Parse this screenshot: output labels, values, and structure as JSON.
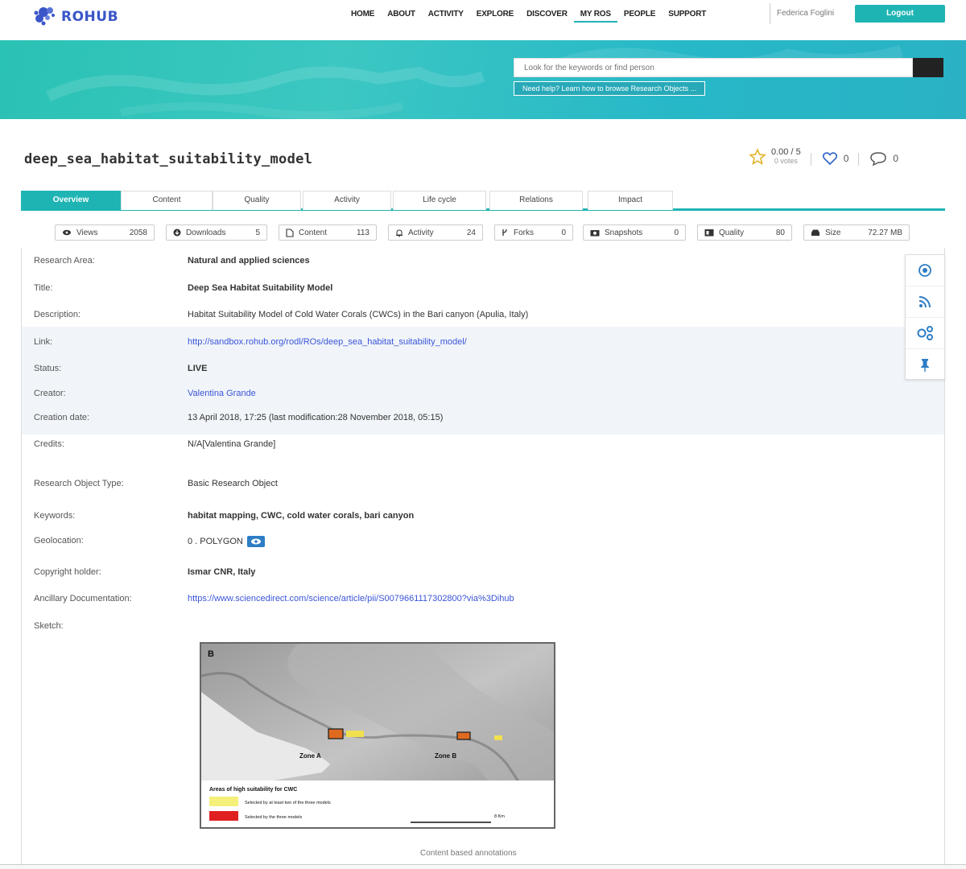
{
  "header": {
    "logo_text": "ROHUB",
    "nav": [
      "HOME",
      "ABOUT",
      "ACTIVITY",
      "EXPLORE",
      "DISCOVER",
      "MY ROS",
      "PEOPLE",
      "SUPPORT"
    ],
    "active_nav": "MY ROS",
    "user_name": "Federica Foglini",
    "logout_label": "Logout",
    "accent_color": "#1fb4b4"
  },
  "search": {
    "placeholder": "Look for the keywords or find person",
    "help_label": "Need help? Learn how to browse Research Objects ..."
  },
  "ro": {
    "title": "deep_sea_habitat_suitability_model",
    "rating": "0.00 / 5",
    "votes": "0 votes",
    "likes": "0",
    "comments": "0"
  },
  "tabs": [
    "Overview",
    "Content",
    "Quality",
    "Activity",
    "Life cycle",
    "Relations",
    "Impact"
  ],
  "stats": [
    {
      "icon": "eye-icon",
      "label": "Views",
      "value": "2058"
    },
    {
      "icon": "download-icon",
      "label": "Downloads",
      "value": "5"
    },
    {
      "icon": "file-icon",
      "label": "Content",
      "value": "113"
    },
    {
      "icon": "bell-icon",
      "label": "Activity",
      "value": "24"
    },
    {
      "icon": "fork-icon",
      "label": "Forks",
      "value": "0"
    },
    {
      "icon": "camera-icon",
      "label": "Snapshots",
      "value": "0"
    },
    {
      "icon": "quality-icon",
      "label": "Quality",
      "value": "80"
    },
    {
      "icon": "storage-icon",
      "label": "Size",
      "value": "72.27 MB"
    }
  ],
  "details": {
    "research_area": {
      "label": "Research Area:",
      "value": "Natural and applied sciences"
    },
    "title": {
      "label": "Title:",
      "value": "Deep Sea Habitat Suitability Model"
    },
    "description": {
      "label": "Description:",
      "value": "Habitat Suitability Model of Cold Water Corals (CWCs) in the Bari canyon (Apulia, Italy)"
    },
    "link": {
      "label": "Link:",
      "value": "http://sandbox.rohub.org/rodl/ROs/deep_sea_habitat_suitability_model/"
    },
    "status": {
      "label": "Status:",
      "value": "LIVE"
    },
    "creator": {
      "label": "Creator:",
      "value": "Valentina Grande"
    },
    "creation_date": {
      "label": "Creation date:",
      "value": "13 April 2018, 17:25 (last modification:28 November 2018, 05:15)"
    },
    "credits": {
      "label": "Credits:",
      "value": "N/A[Valentina Grande]"
    },
    "ro_type": {
      "label": "Research Object Type:",
      "value": "Basic Research Object"
    },
    "keywords": {
      "label": "Keywords:",
      "value": "habitat mapping, CWC, cold water corals, bari canyon"
    },
    "geolocation": {
      "label": "Geolocation:",
      "value": "0 . POLYGON"
    },
    "copyright": {
      "label": "Copyright holder:",
      "value": "Ismar CNR, Italy"
    },
    "ancillary": {
      "label": "Ancillary Documentation:",
      "value": "https://www.sciencedirect.com/science/article/pii/S0079661117302800?via%3Dihub"
    },
    "sketch": {
      "label": "Sketch:"
    }
  },
  "sketch_image": {
    "panel_letter": "B",
    "zone_a": "Zone A",
    "zone_b": "Zone B",
    "legend_title": "Areas of high suitability for CWC",
    "legend_yellow": "Selected by at least two of the three models",
    "legend_red": "Selected by the three models",
    "scale_label": "8 Km",
    "caption": "Content based annotations"
  }
}
